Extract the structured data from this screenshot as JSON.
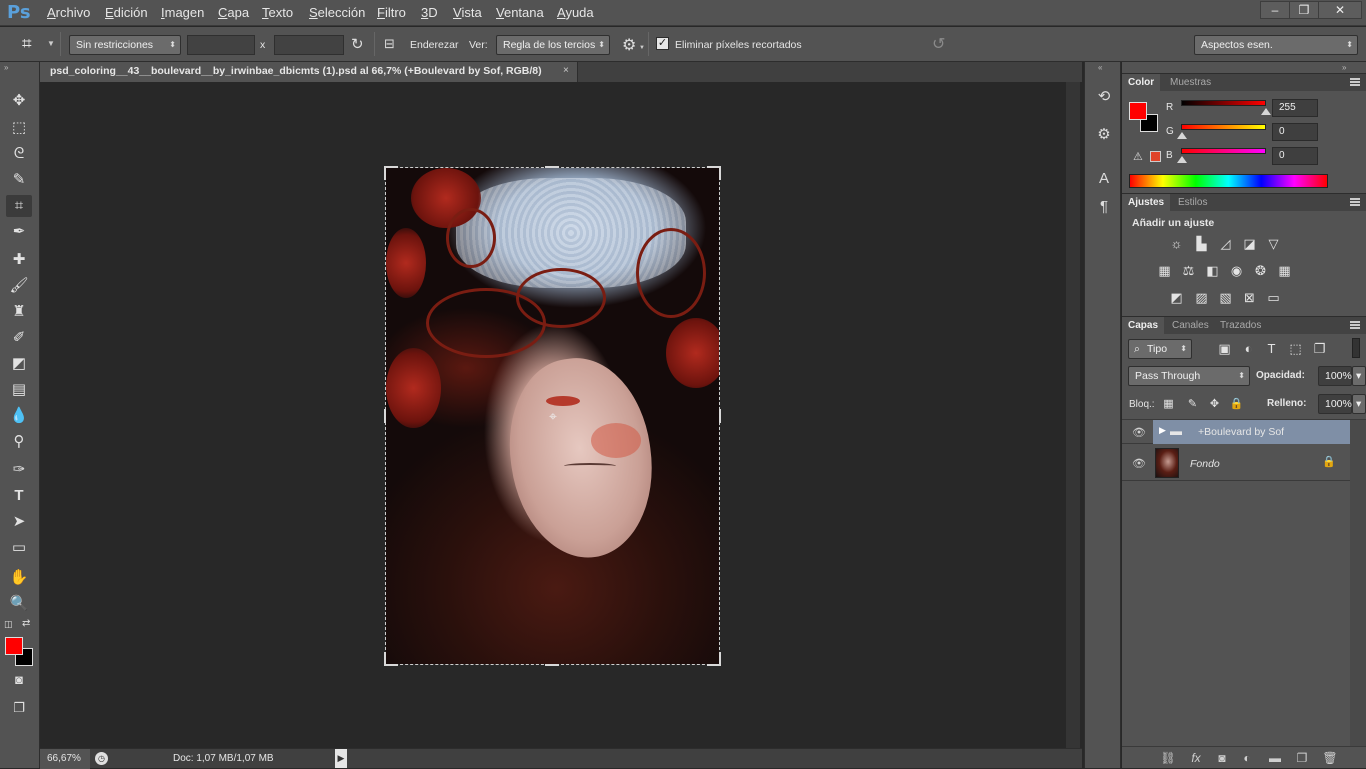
{
  "app": {
    "logo": "Ps"
  },
  "menu": [
    "Archivo",
    "Edición",
    "Imagen",
    "Capa",
    "Texto",
    "Selección",
    "Filtro",
    "3D",
    "Vista",
    "Ventana",
    "Ayuda"
  ],
  "window_controls": {
    "minimize": "–",
    "restore": "❐",
    "close": "✕"
  },
  "options_bar": {
    "ratio_select": "Sin restricciones",
    "width_value": "",
    "times_label": "x",
    "height_value": "",
    "straighten_label": "Enderezar",
    "view_label": "Ver:",
    "view_select": "Regla de los tercios",
    "delete_pixels_label": "Eliminar píxeles recortados",
    "delete_pixels_checked": true,
    "workspace_select": "Aspectos esen."
  },
  "document": {
    "tab_title": "psd_coloring__43__boulevard__by_irwinbae_dbicmts (1).psd al 66,7% (+Boulevard by Sof, RGB/8)",
    "tab_close": "×"
  },
  "status": {
    "zoom": "66,67%",
    "doc_info": "Doc: 1,07 MB/1,07 MB",
    "arrow": "▶"
  },
  "color_panel": {
    "tabs": [
      "Color",
      "Muestras"
    ],
    "foreground": "#ff0000",
    "background": "#000000",
    "channels": [
      {
        "label": "R",
        "value": "255"
      },
      {
        "label": "G",
        "value": "0"
      },
      {
        "label": "B",
        "value": "0"
      }
    ]
  },
  "adjustments_panel": {
    "tabs": [
      "Ajustes",
      "Estilos"
    ],
    "heading": "Añadir un ajuste"
  },
  "layers_panel": {
    "tabs": [
      "Capas",
      "Canales",
      "Trazados"
    ],
    "filter_select": "Tipo",
    "blend_mode": "Pass Through",
    "opacity_label": "Opacidad:",
    "opacity_value": "100%",
    "lock_label": "Bloq.:",
    "fill_label": "Relleno:",
    "fill_value": "100%",
    "layers": [
      {
        "name": "+Boulevard by Sof",
        "type": "group",
        "selected": true
      },
      {
        "name": "Fondo",
        "type": "background",
        "locked": true
      }
    ]
  },
  "colors": {
    "accent": "#5aa0db",
    "panel": "#535353",
    "canvas": "#282828",
    "selected_layer": "#7f8fa6"
  }
}
